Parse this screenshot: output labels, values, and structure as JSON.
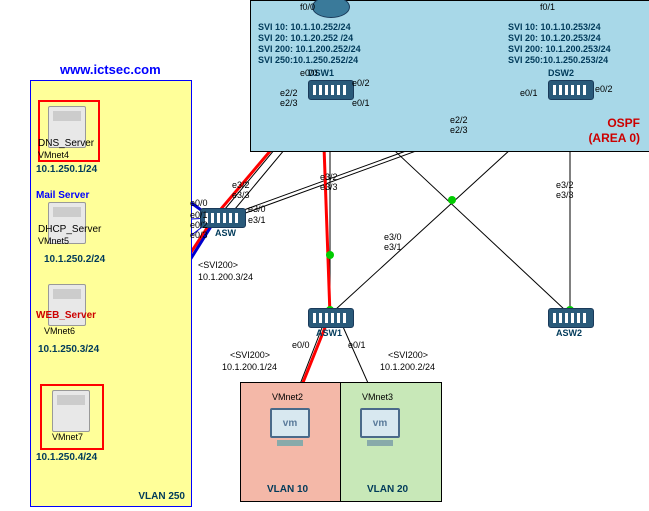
{
  "site_url": "www.ictsec.com",
  "zones": {
    "servers": {
      "vlan": "VLAN 250",
      "dns": {
        "name": "DNS_Server",
        "vmnet": "VMnet4",
        "ip": "10.1.250.1/24"
      },
      "mail": {
        "title": "Mail Server"
      },
      "dhcp": {
        "name": "DHCP_Server",
        "vmnet": "VMnet5",
        "ip": "10.1.250.2/24"
      },
      "web": {
        "name": "WEB_Server",
        "vmnet": "VMnet6",
        "ip": "10.1.250.3/24"
      },
      "last": {
        "vmnet": "VMnet7",
        "ip": "10.1.250.4/24"
      }
    },
    "core": {
      "ospf": "OSPF",
      "area": "(AREA 0)",
      "dsw1": {
        "name": "DSW1",
        "svi10": "SVI 10: 10.1.10.252/24",
        "svi20": "SVI 20: 10.1.20.252 /24",
        "svi200": "SVI 200: 10.1.200.252/24",
        "svi250": "SVI 250:10.1.250.252/24"
      },
      "dsw2": {
        "name": "DSW2",
        "svi10": "SVI 10: 10.1.10.253/24",
        "svi20": "SVI 20: 10.1.20.253/24",
        "svi200": "SVI 200: 10.1.200.253/24",
        "svi250": "SVI 250:10.1.250.253/24"
      },
      "p": {
        "f00": "f0/0",
        "f01": "f0/1",
        "e00": "e0/0",
        "e01": "e0/1",
        "e02": "e0/2",
        "e03": "e0/3",
        "e22": "e2/2",
        "e23": "e2/3",
        "e30": "e3/0",
        "e31": "e3/1",
        "e32": "e3/2",
        "e33": "e3/3"
      }
    },
    "asw": {
      "name": "ASW",
      "svi200_a": "<SVI200>",
      "svi200_b": "10.1.200.3/24"
    },
    "asw1": {
      "name": "ASW1",
      "svi200_tag": "<SVI200>",
      "svi200_ip": "10.1.200.1/24"
    },
    "asw2": {
      "name": "ASW2",
      "svi200_tag": "<SVI200>",
      "svi200_ip": "10.1.200.2/24"
    },
    "hosts": {
      "vlan10": "VLAN 10",
      "vlan20": "VLAN 20",
      "h1": "VMnet2",
      "h2": "VMnet3",
      "vm": "vm"
    }
  }
}
